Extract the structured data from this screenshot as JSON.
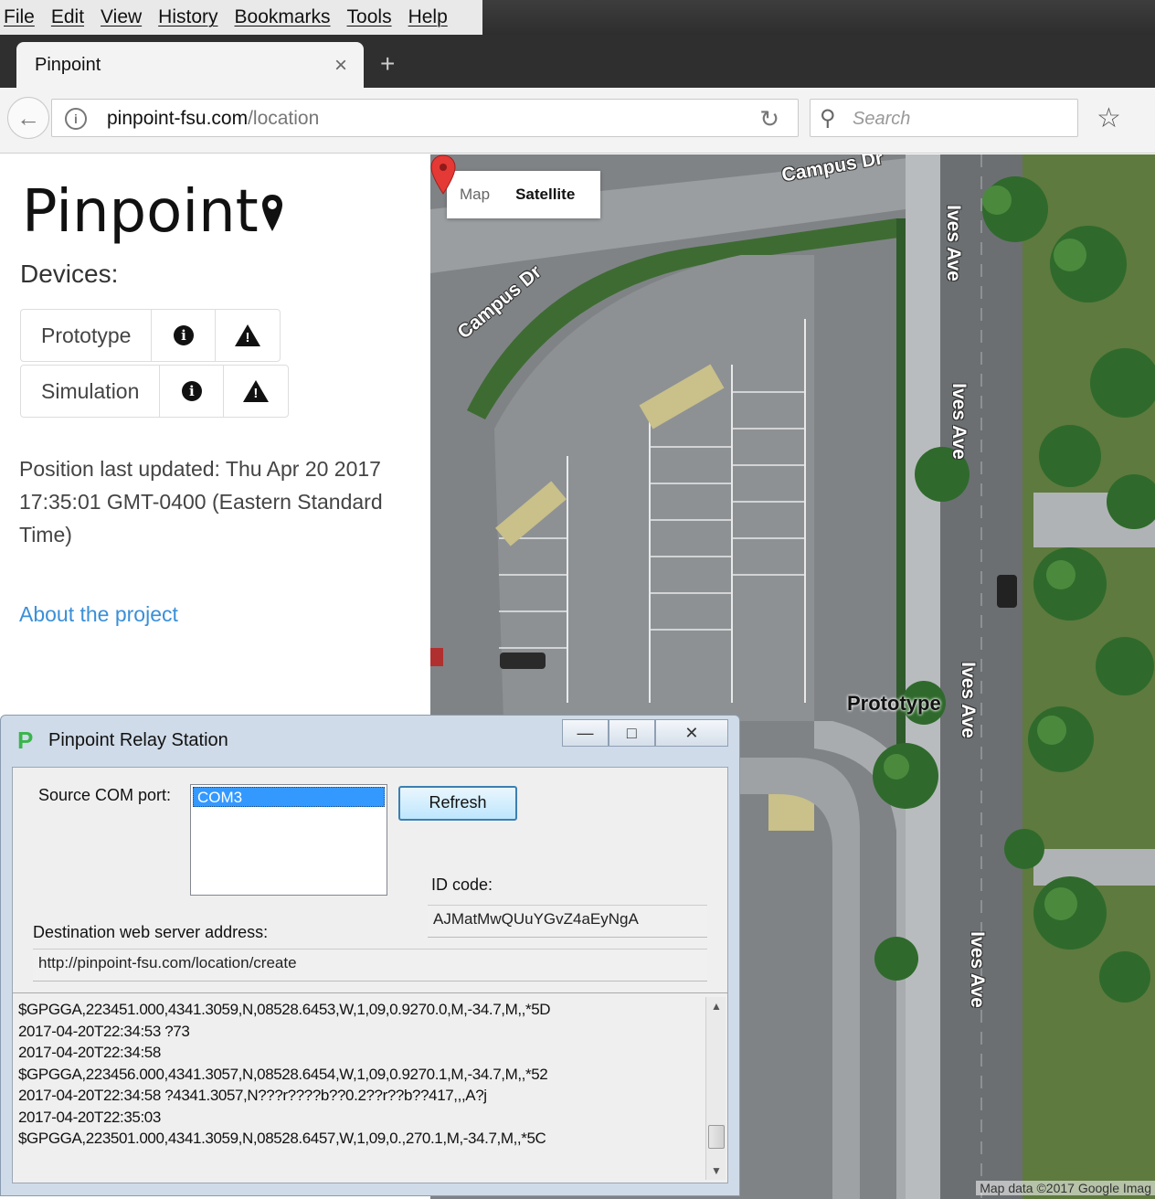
{
  "browser": {
    "menu": [
      "File",
      "Edit",
      "View",
      "History",
      "Bookmarks",
      "Tools",
      "Help"
    ],
    "tab_title": "Pinpoint",
    "tab_close": "×",
    "new_tab": "+",
    "url_host": "pinpoint-fsu.com",
    "url_path": "/location",
    "search_placeholder": "Search"
  },
  "page": {
    "logo": "Pinpoint",
    "devices_title": "Devices:",
    "devices": [
      {
        "name": "Prototype"
      },
      {
        "name": "Simulation"
      }
    ],
    "position_updated": "Position last updated: Thu Apr 20 2017 17:35:01 GMT-0400 (Eastern Standard Time)",
    "about_link": "About the project"
  },
  "map": {
    "type_map": "Map",
    "type_satellite": "Satellite",
    "selected_type": "Satellite",
    "streets": [
      "Campus Dr",
      "Campus Dr",
      "Ives Ave",
      "Ives Ave",
      "Ives Ave",
      "Ives Ave"
    ],
    "marker_label": "Prototype",
    "marker_color": "#e53935",
    "attribution": "Map data ©2017 Google Imag"
  },
  "relay": {
    "title": "Pinpoint Relay Station",
    "logo_letter": "P",
    "logo_color": "#39b54a",
    "source_label": "Source COM port:",
    "com_ports": [
      "COM3"
    ],
    "refresh_label": "Refresh",
    "id_label": "ID code:",
    "id_value": "AJMatMwQUuYGvZ4aEyNgA",
    "dest_label": "Destination web server address:",
    "dest_value": "http://pinpoint-fsu.com/location/create",
    "log": [
      "$GPGGA,223451.000,4341.3059,N,08528.6453,W,1,09,0.9270.0,M,-34.7,M,,*5D",
      "2017-04-20T22:34:53 ?73",
      "2017-04-20T22:34:58",
      "$GPGGA,223456.000,4341.3057,N,08528.6454,W,1,09,0.9270.1,M,-34.7,M,,*52",
      "2017-04-20T22:34:58 ?4341.3057,N???r????b??0.2??r??b??417,,,A?j",
      "2017-04-20T22:35:03",
      "$GPGGA,223501.000,4341.3059,N,08528.6457,W,1,09,0.,270.1,M,-34.7,M,,*5C"
    ]
  }
}
